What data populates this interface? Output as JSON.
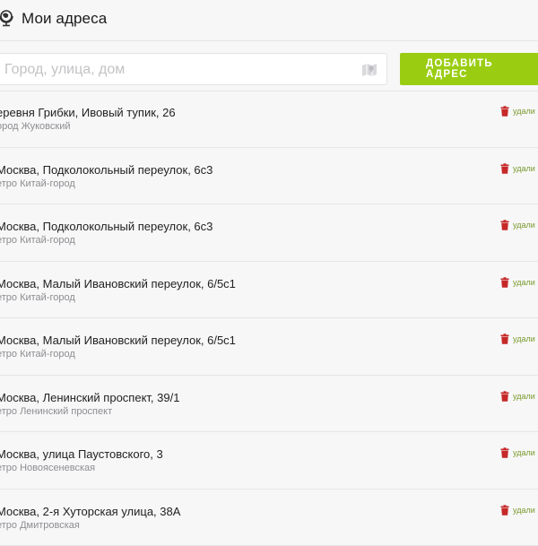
{
  "header": {
    "title": "Мои адреса",
    "icon": "globe-icon"
  },
  "search": {
    "placeholder": "Город, улица, дом",
    "value": "",
    "icon": "map-icon"
  },
  "add_button": {
    "label": "ДОБАВИТЬ АДРЕС"
  },
  "colors": {
    "accent": "#9acd12",
    "delete_icon": "#c62828",
    "delete_text": "#7a9a2c"
  },
  "addresses": [
    {
      "title": "еревня Грибки, Ивовый тупик, 26",
      "subtitle": "ород Жуковский",
      "delete_label": "удали"
    },
    {
      "title": "Москва, Подколокольный переулок, 6с3",
      "subtitle": "етро Китай-город",
      "delete_label": "удали"
    },
    {
      "title": "Москва, Подколокольный переулок, 6с3",
      "subtitle": "етро Китай-город",
      "delete_label": "удали"
    },
    {
      "title": "Москва, Малый Ивановский переулок, 6/5с1",
      "subtitle": "етро Китай-город",
      "delete_label": "удали"
    },
    {
      "title": "Москва, Малый Ивановский переулок, 6/5с1",
      "subtitle": "етро Китай-город",
      "delete_label": "удали"
    },
    {
      "title": "Москва, Ленинский проспект, 39/1",
      "subtitle": "етро Ленинский проспект",
      "delete_label": "удали"
    },
    {
      "title": "Москва, улица Паустовского, 3",
      "subtitle": "етро Новоясеневская",
      "delete_label": "удали"
    },
    {
      "title": "Москва, 2-я Хуторская улица, 38А",
      "subtitle": "етро Дмитровская",
      "delete_label": "удали"
    }
  ]
}
